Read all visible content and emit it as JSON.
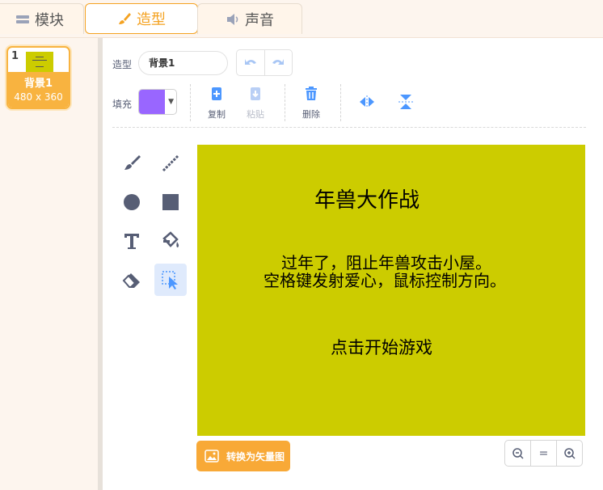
{
  "tabs": [
    {
      "label": "模块"
    },
    {
      "label": "造型"
    },
    {
      "label": "声音"
    }
  ],
  "costume_list": {
    "items": [
      {
        "number": "1",
        "name": "背景1",
        "size": "480 x 360"
      }
    ]
  },
  "editor": {
    "costume_label": "造型",
    "costume_name": "背景1",
    "fill_label": "填充",
    "fill_color": "#9966ff",
    "copy_label": "复制",
    "paste_label": "粘贴",
    "delete_label": "删除",
    "convert_label": "转换为矢量图",
    "zoom_reset_label": "="
  },
  "canvas": {
    "background": "#cccc00",
    "title": "年兽大作战",
    "line1": "过年了，阻止年兽攻击小屋。",
    "line2": "空格键发射爱心，鼠标控制方向。",
    "line3": "点击开始游戏"
  },
  "colors": {
    "accent": "#f4a221",
    "tool_icon": "#575e75",
    "tool_blue": "#4c97ff"
  }
}
